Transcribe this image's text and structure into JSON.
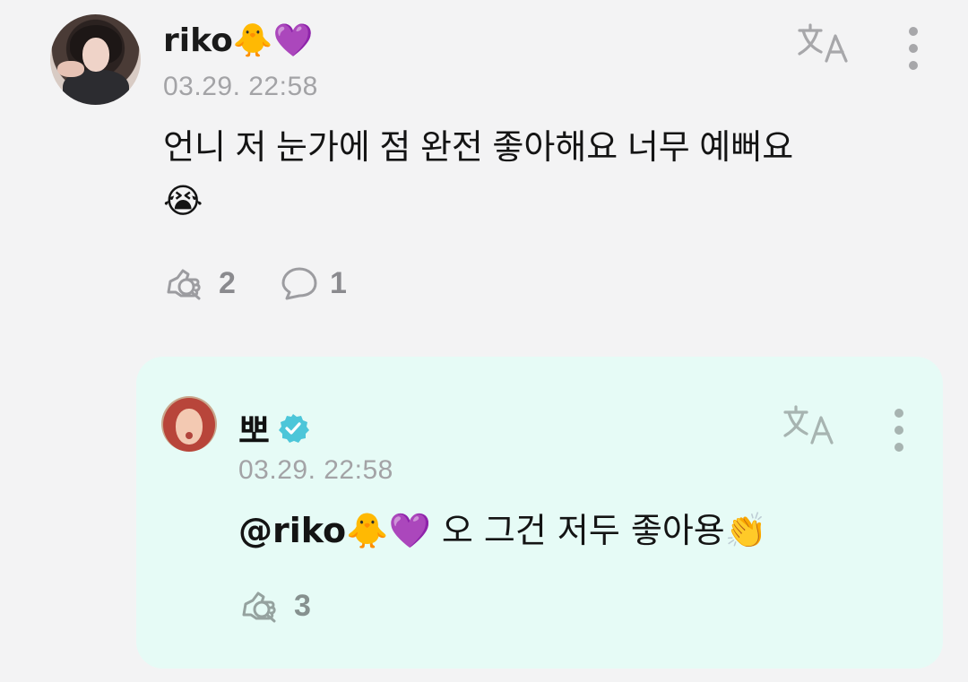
{
  "comment": {
    "username": "riko🐥💜",
    "timestamp": "03.29. 22:58",
    "text": "언니 저 눈가에 점 완전 좋아해요 너무 예뻐요",
    "text_emoji": "😭",
    "like_count": "2",
    "reply_count": "1",
    "icons": [
      "avatar",
      "translate-icon",
      "more-options-icon",
      "like-icon",
      "reply-icon"
    ]
  },
  "reply": {
    "username": "뽀",
    "timestamp": "03.29. 22:58",
    "mention": "@riko🐥💜",
    "text": " 오 그건 저두 좋아용👏",
    "like_count": "3",
    "icons": [
      "avatar",
      "verified-badge-icon",
      "translate-icon",
      "more-options-icon",
      "like-icon"
    ]
  },
  "colors": {
    "background": "#f3f3f4",
    "reply_background": "#e6fbf6",
    "muted_text": "#a3a3a6",
    "action_count": "#8a8a8e",
    "verified": "#4cc6d9"
  }
}
